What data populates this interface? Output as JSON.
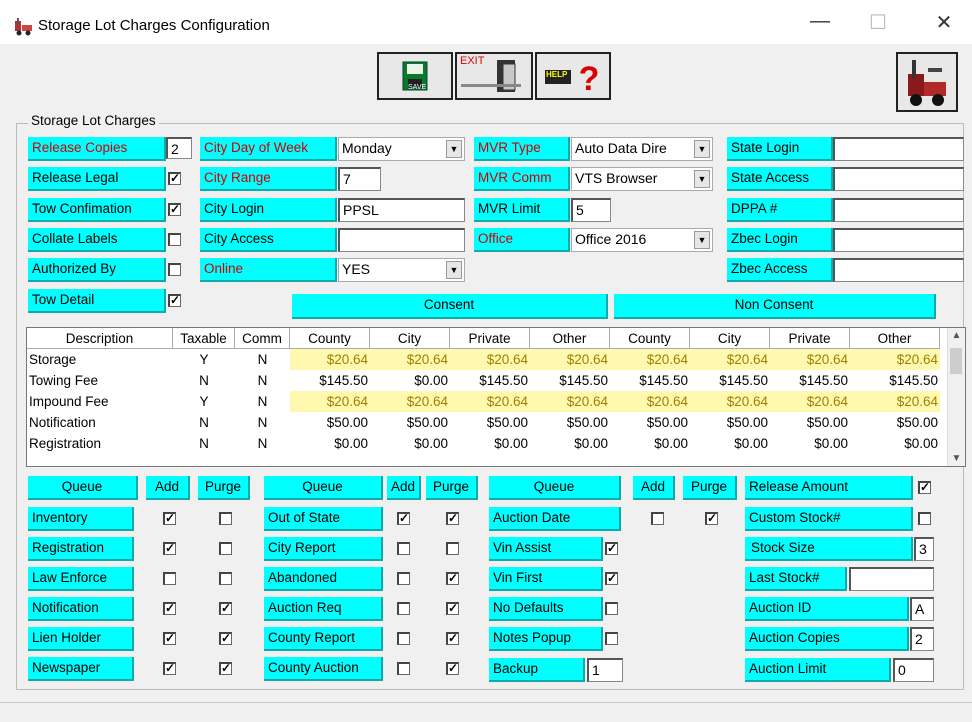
{
  "window": {
    "title": "Storage Lot Charges Configuration",
    "minimize": "—",
    "maximize": "☐",
    "close": "✕"
  },
  "toolbar": {
    "save_label": "SAVE",
    "exit_label": "EXIT",
    "help_label": "HELP"
  },
  "group_title": "Storage Lot Charges",
  "col1": {
    "release_copies": {
      "label": "Release Copies",
      "value": "2"
    },
    "release_legal": {
      "label": "Release Legal",
      "checked": true
    },
    "tow_confirmation": {
      "label": "Tow Confimation",
      "checked": true
    },
    "collate_labels": {
      "label": "Collate Labels",
      "checked": false
    },
    "authorized_by": {
      "label": "Authorized By",
      "checked": false
    },
    "tow_detail": {
      "label": "Tow Detail",
      "checked": true
    }
  },
  "col2": {
    "city_day": {
      "label": "City Day of Week",
      "value": "Monday"
    },
    "city_range": {
      "label": "City Range",
      "value": "7"
    },
    "city_login": {
      "label": "City Login",
      "value": "PPSL"
    },
    "city_access": {
      "label": "City Access",
      "value": ""
    },
    "online": {
      "label": "Online",
      "value": "YES"
    }
  },
  "col3": {
    "mvr_type": {
      "label": "MVR Type",
      "value": "Auto Data Dire"
    },
    "mvr_comm": {
      "label": "MVR Comm",
      "value": "VTS Browser"
    },
    "mvr_limit": {
      "label": "MVR Limit",
      "value": "5"
    },
    "office": {
      "label": "Office",
      "value": "Office 2016"
    }
  },
  "col4": {
    "state_login": {
      "label": "State Login",
      "value": ""
    },
    "state_access": {
      "label": "State Access",
      "value": ""
    },
    "dppa": {
      "label": "DPPA #",
      "value": ""
    },
    "zbec_login": {
      "label": "Zbec Login",
      "value": ""
    },
    "zbec_access": {
      "label": "Zbec Access",
      "value": ""
    }
  },
  "bands": {
    "consent": "Consent",
    "non_consent": "Non Consent"
  },
  "grid": {
    "headers": [
      "Description",
      "Taxable",
      "Comm",
      "County",
      "City",
      "Private",
      "Other",
      "County",
      "City",
      "Private",
      "Other"
    ],
    "rows": [
      {
        "cells": [
          "Storage",
          "Y",
          "N",
          "$20.64",
          "$20.64",
          "$20.64",
          "$20.64",
          "$20.64",
          "$20.64",
          "$20.64",
          "$20.64"
        ],
        "highlight": true
      },
      {
        "cells": [
          "Towing Fee",
          "N",
          "N",
          "$145.50",
          "$0.00",
          "$145.50",
          "$145.50",
          "$145.50",
          "$145.50",
          "$145.50",
          "$145.50"
        ],
        "highlight": false
      },
      {
        "cells": [
          "Impound Fee",
          "Y",
          "N",
          "$20.64",
          "$20.64",
          "$20.64",
          "$20.64",
          "$20.64",
          "$20.64",
          "$20.64",
          "$20.64"
        ],
        "highlight": true
      },
      {
        "cells": [
          "Notification",
          "N",
          "N",
          "$50.00",
          "$50.00",
          "$50.00",
          "$50.00",
          "$50.00",
          "$50.00",
          "$50.00",
          "$50.00"
        ],
        "highlight": false
      },
      {
        "cells": [
          "Registration",
          "N",
          "N",
          "$0.00",
          "$0.00",
          "$0.00",
          "$0.00",
          "$0.00",
          "$0.00",
          "$0.00",
          "$0.00"
        ],
        "highlight": false
      }
    ]
  },
  "queue_headers": {
    "queue": "Queue",
    "add": "Add",
    "purge": "Purge"
  },
  "queue1": [
    {
      "label": "Inventory",
      "add": true,
      "purge": false
    },
    {
      "label": "Registration",
      "add": true,
      "purge": false
    },
    {
      "label": "Law Enforce",
      "add": false,
      "purge": false
    },
    {
      "label": "Notification",
      "add": true,
      "purge": true
    },
    {
      "label": "Lien Holder",
      "add": true,
      "purge": true
    },
    {
      "label": "Newspaper",
      "add": true,
      "purge": true
    }
  ],
  "queue2": [
    {
      "label": "Out of State",
      "add": true,
      "purge": true
    },
    {
      "label": "City Report",
      "add": false,
      "purge": false
    },
    {
      "label": "Abandoned",
      "add": false,
      "purge": true
    },
    {
      "label": "Auction Req",
      "add": false,
      "purge": true
    },
    {
      "label": "County Report",
      "add": false,
      "purge": true
    },
    {
      "label": "County Auction",
      "add": false,
      "purge": true
    }
  ],
  "queue3": {
    "auction_date": {
      "label": "Auction Date",
      "add": false,
      "purge": true
    },
    "vin_assist": {
      "label": "Vin Assist",
      "checked": true
    },
    "vin_first": {
      "label": "Vin First",
      "checked": true
    },
    "no_defaults": {
      "label": "No Defaults",
      "checked": false
    },
    "notes_popup": {
      "label": "Notes Popup",
      "checked": false
    },
    "backup": {
      "label": "Backup",
      "value": "1"
    }
  },
  "col5": {
    "release_amount": {
      "label": "Release Amount",
      "checked": true
    },
    "custom_stock": {
      "label": "Custom Stock#",
      "checked": false
    },
    "stock_size": {
      "label": "Stock Size",
      "value": "3"
    },
    "last_stock": {
      "label": "Last Stock#",
      "value": ""
    },
    "auction_id": {
      "label": "Auction ID",
      "value": "A"
    },
    "auction_copies": {
      "label": "Auction Copies",
      "value": "2"
    },
    "auction_limit": {
      "label": "Auction Limit",
      "value": "0"
    }
  }
}
